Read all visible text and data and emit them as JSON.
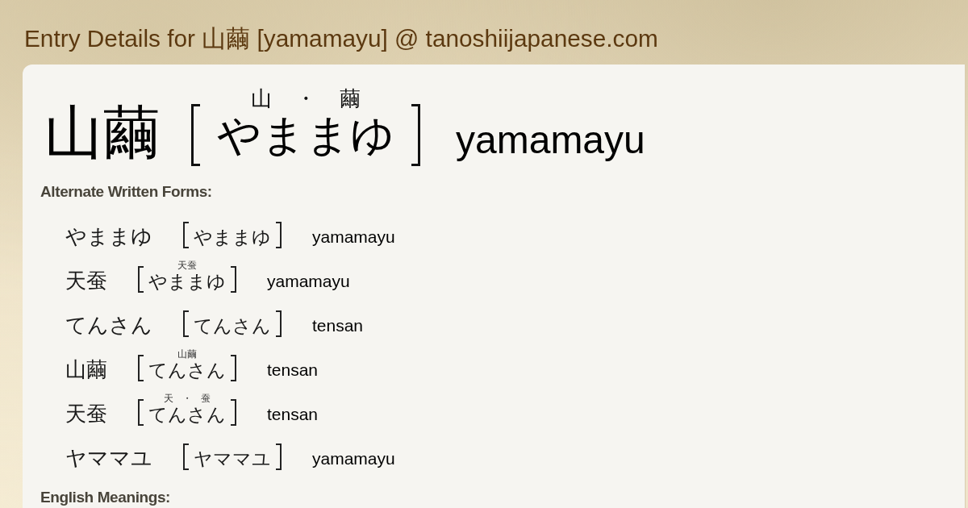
{
  "page": {
    "title": "Entry Details for 山繭 [yamamayu] @ tanoshiijapanese.com"
  },
  "entry": {
    "written": "山繭",
    "furigana": "山 ・ 繭",
    "reading": "やままゆ",
    "romaji": "yamamayu"
  },
  "alternate_forms": {
    "heading": "Alternate Written Forms:",
    "items": [
      {
        "written": "やままゆ",
        "reading": "やままゆ",
        "romaji": "yamamayu"
      },
      {
        "written": "天蚕",
        "furigana": "天蚕",
        "reading": "やままゆ",
        "romaji": "yamamayu"
      },
      {
        "written": "てんさん",
        "reading": "てんさん",
        "romaji": "tensan"
      },
      {
        "written": "山繭",
        "furigana": "山繭",
        "reading": "てんさん",
        "romaji": "tensan"
      },
      {
        "written": "天蚕",
        "furigana": "天 ・ 蚕",
        "reading": "てんさん",
        "romaji": "tensan"
      },
      {
        "written": "ヤママユ",
        "reading": "ヤママユ",
        "romaji": "yamamayu"
      }
    ]
  },
  "meanings": {
    "heading": "English Meanings:"
  }
}
